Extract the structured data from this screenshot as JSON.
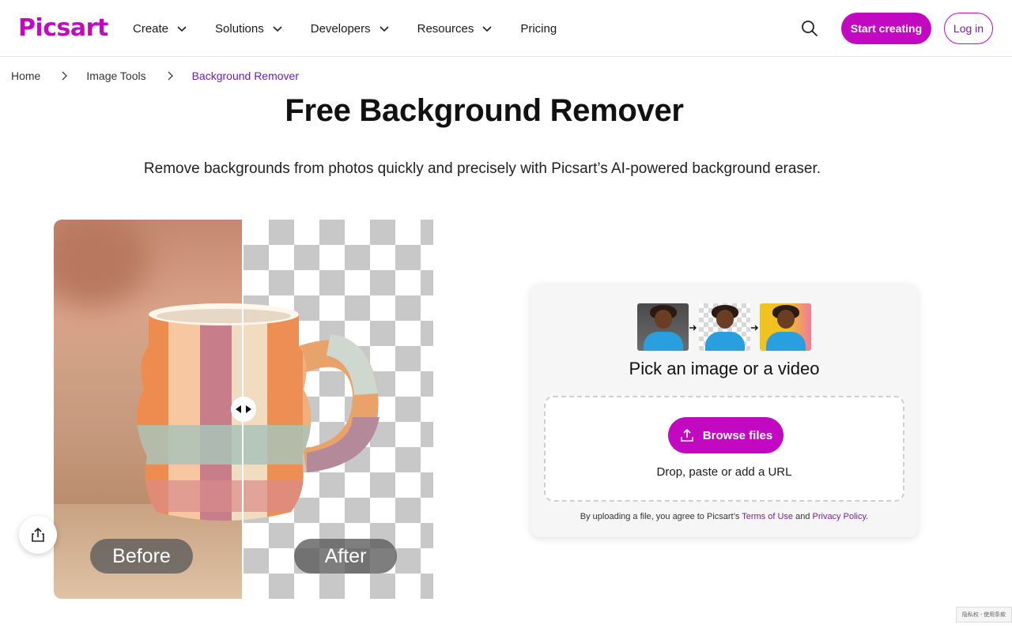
{
  "header": {
    "logo": "Picsart",
    "nav": [
      {
        "label": "Create",
        "has_dropdown": true
      },
      {
        "label": "Solutions",
        "has_dropdown": true
      },
      {
        "label": "Developers",
        "has_dropdown": true
      },
      {
        "label": "Resources",
        "has_dropdown": true
      },
      {
        "label": "Pricing",
        "has_dropdown": false
      }
    ],
    "search_icon": "search-icon",
    "start_button": "Start creating",
    "login_button": "Log in"
  },
  "breadcrumb": {
    "items": [
      "Home",
      "Image Tools",
      "Background Remover"
    ]
  },
  "hero": {
    "title": "Free Background Remover",
    "subtitle": "Remove backgrounds from photos quickly and precisely with Picsart’s AI-powered background eraser."
  },
  "demo": {
    "before_label": "Before",
    "after_label": "After",
    "share_icon": "share-icon",
    "slider_position_fraction": 0.5
  },
  "upload": {
    "title": "Pick an image or a video",
    "browse_button": "Browse files",
    "drop_text": "Drop, paste or add a URL",
    "legal_prefix": "By uploading a file, you agree to Picsart’s",
    "terms_link": "Terms of Use",
    "legal_and": "and",
    "privacy_link": "Privacy Policy",
    "legal_suffix": "."
  },
  "recaptcha": {
    "text": "隐私权 - 使用条款"
  },
  "colors": {
    "brand": "#c209c1",
    "link": "#7a1fa2",
    "breadcrumb_current": "#6a1fb0"
  }
}
